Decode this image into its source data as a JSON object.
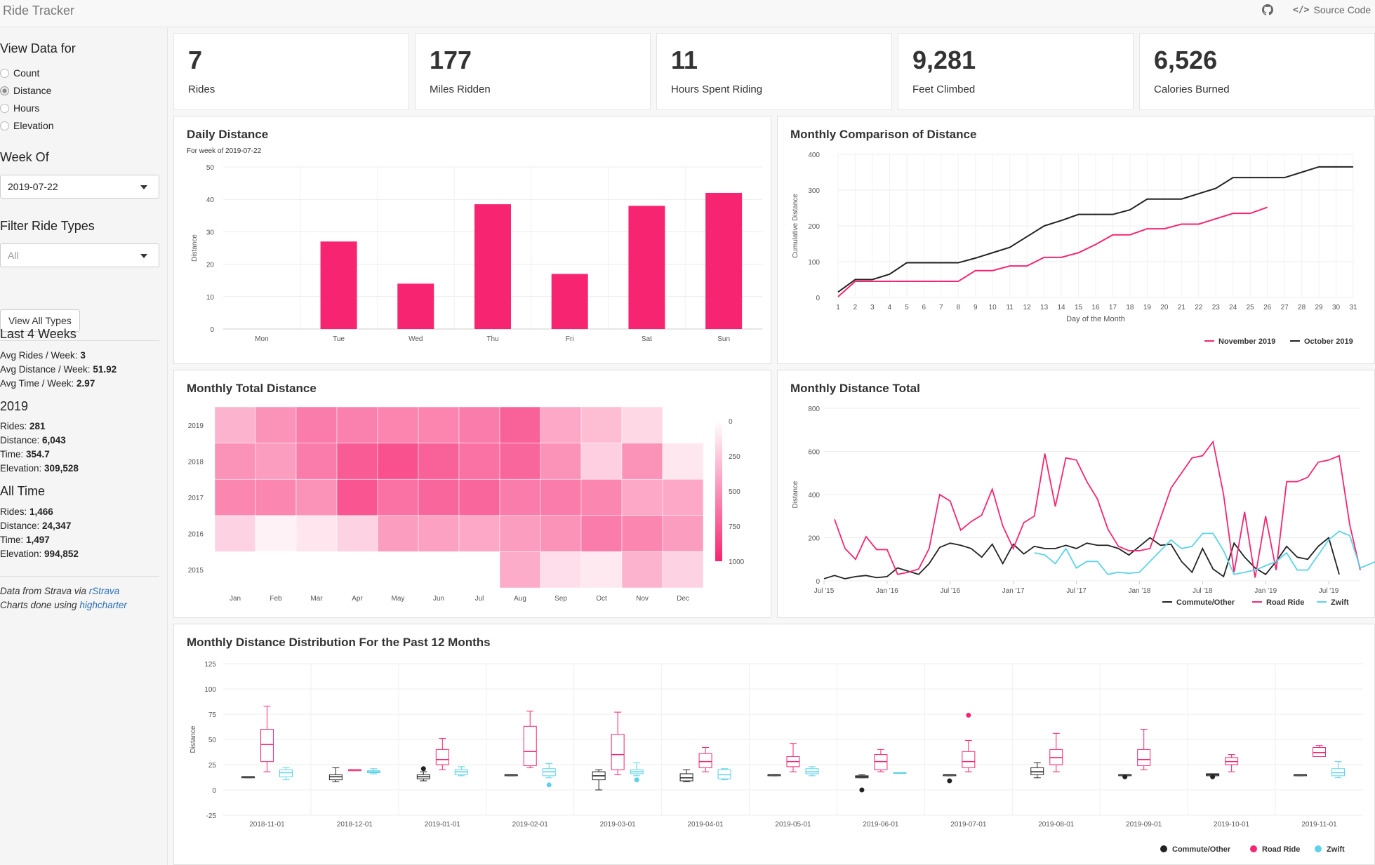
{
  "nav": {
    "brand": "Ride Tracker",
    "source_code": "Source Code"
  },
  "sidebar": {
    "view_heading": "View Data for",
    "view_options": [
      {
        "label": "Count",
        "checked": false
      },
      {
        "label": "Distance",
        "checked": true
      },
      {
        "label": "Hours",
        "checked": false
      },
      {
        "label": "Elevation",
        "checked": false
      }
    ],
    "week_heading": "Week Of",
    "week_value": "2019-07-22",
    "filter_heading": "Filter Ride Types",
    "filter_value": "All",
    "view_all_button": "View All Types",
    "last4_heading": "Last 4 Weeks",
    "last4": [
      {
        "label": "Avg Rides / Week: ",
        "value": "3"
      },
      {
        "label": "Avg Distance / Week: ",
        "value": "51.92"
      },
      {
        "label": "Avg Time / Week: ",
        "value": "2.97"
      }
    ],
    "y2019_heading": "2019",
    "y2019": [
      {
        "label": "Rides: ",
        "value": "281"
      },
      {
        "label": "Distance: ",
        "value": "6,043"
      },
      {
        "label": "Time: ",
        "value": "354.7"
      },
      {
        "label": "Elevation: ",
        "value": "309,528"
      }
    ],
    "alltime_heading": "All Time",
    "alltime": [
      {
        "label": "Rides: ",
        "value": "1,466"
      },
      {
        "label": "Distance: ",
        "value": "24,347"
      },
      {
        "label": "Time: ",
        "value": "1,497"
      },
      {
        "label": "Elevation: ",
        "value": "994,852"
      }
    ],
    "credit1_prefix": "Data from Strava via ",
    "credit1_link": "rStrava",
    "credit2_prefix": "Charts done using ",
    "credit2_link": "highcharter"
  },
  "value_boxes": [
    {
      "value": "7",
      "label": "Rides"
    },
    {
      "value": "177",
      "label": "Miles Ridden"
    },
    {
      "value": "11",
      "label": "Hours Spent Riding"
    },
    {
      "value": "9,281",
      "label": "Feet Climbed"
    },
    {
      "value": "6,526",
      "label": "Calories Burned"
    }
  ],
  "colors": {
    "pink": "#f72571",
    "black": "#222222",
    "cyan": "#5bd3e8"
  },
  "cards": {
    "daily": "Daily Distance",
    "monthly_comparison": "Monthly Comparison of Distance",
    "monthly_total": "Monthly Total Distance",
    "monthly_distance_total": "Monthly Distance Total",
    "distribution": "Monthly Distance Distribution For the Past 12 Months"
  },
  "chart_data": [
    {
      "id": "daily",
      "type": "bar",
      "title": "Daily Distance",
      "subtitle": "For week of 2019-07-22",
      "ylabel": "Distance",
      "xlabel": "",
      "categories": [
        "Mon",
        "Tue",
        "Wed",
        "Thu",
        "Fri",
        "Sat",
        "Sun"
      ],
      "values": [
        0,
        27,
        14,
        38.5,
        17,
        38,
        42
      ],
      "ylim": [
        0,
        50
      ],
      "yticks": [
        0,
        10,
        20,
        30,
        40,
        50
      ],
      "color": "#f72571"
    },
    {
      "id": "comparison",
      "type": "line",
      "title": "Monthly Comparison of Distance",
      "xlabel": "Day of the Month",
      "ylabel": "Cumulative Distance",
      "ylim": [
        0,
        400
      ],
      "yticks": [
        0,
        100,
        200,
        300,
        400
      ],
      "x": [
        1,
        2,
        3,
        4,
        5,
        6,
        7,
        8,
        9,
        10,
        11,
        12,
        13,
        14,
        15,
        16,
        17,
        18,
        19,
        20,
        21,
        22,
        23,
        24,
        25,
        26,
        27,
        28,
        29,
        30,
        31
      ],
      "legend_position": "bottom-right",
      "series": [
        {
          "name": "November 2019",
          "color": "#f72571",
          "values": [
            2,
            45,
            45,
            45,
            45,
            45,
            45,
            45,
            75,
            75,
            88,
            88,
            112,
            112,
            125,
            148,
            175,
            175,
            192,
            192,
            205,
            205,
            220,
            235,
            235,
            252
          ]
        },
        {
          "name": "October 2019",
          "color": "#222222",
          "values": [
            15,
            50,
            50,
            65,
            97,
            97,
            97,
            97,
            110,
            125,
            140,
            170,
            200,
            215,
            232,
            232,
            232,
            245,
            275,
            275,
            275,
            290,
            305,
            335,
            335,
            335,
            335,
            350,
            365,
            365,
            365
          ]
        }
      ]
    },
    {
      "id": "heatmap",
      "type": "heatmap",
      "title": "Monthly Total Distance",
      "x_categories": [
        "Jan",
        "Feb",
        "Mar",
        "Apr",
        "May",
        "Jun",
        "Jul",
        "Aug",
        "Sep",
        "Oct",
        "Nov",
        "Dec"
      ],
      "y_categories": [
        "2019",
        "2018",
        "2017",
        "2016",
        "2015"
      ],
      "color_range": [
        0,
        1000
      ],
      "legend_ticks": [
        0,
        250,
        500,
        750,
        1000
      ],
      "values": [
        [
          350,
          500,
          600,
          580,
          560,
          560,
          600,
          720,
          400,
          300,
          180,
          null
        ],
        [
          500,
          450,
          600,
          750,
          800,
          720,
          650,
          700,
          500,
          220,
          500,
          110
        ],
        [
          550,
          550,
          500,
          780,
          650,
          700,
          700,
          600,
          600,
          550,
          400,
          400
        ],
        [
          200,
          60,
          120,
          200,
          450,
          430,
          400,
          450,
          500,
          600,
          550,
          450
        ],
        [
          null,
          null,
          null,
          null,
          null,
          null,
          null,
          380,
          150,
          100,
          350,
          200
        ]
      ]
    },
    {
      "id": "timeseries",
      "type": "line",
      "title": "Monthly Distance Total",
      "ylabel": "Distance",
      "ylim": [
        0,
        800
      ],
      "yticks": [
        0,
        200,
        400,
        600,
        800
      ],
      "xticks": [
        "Jul '15",
        "Jan '16",
        "Jul '16",
        "Jan '17",
        "Jul '17",
        "Jan '18",
        "Jul '18",
        "Jan '19",
        "Jul '19"
      ],
      "legend_position": "bottom-right",
      "series": [
        {
          "name": "Commute/Other",
          "color": "#222222",
          "start_month": 0,
          "values": [
            10,
            25,
            10,
            20,
            25,
            15,
            20,
            60,
            45,
            30,
            80,
            155,
            175,
            165,
            150,
            110,
            170,
            80,
            170,
            125,
            160,
            150,
            150,
            165,
            150,
            175,
            165,
            165,
            150,
            120,
            160,
            200,
            165,
            170,
            90,
            40,
            150,
            55,
            20,
            175,
            110,
            60,
            30,
            90,
            160,
            110,
            100,
            160,
            200,
            30
          ]
        },
        {
          "name": "Road Ride",
          "color": "#f72571",
          "start_month": 1,
          "values": [
            285,
            150,
            100,
            205,
            145,
            145,
            30,
            40,
            55,
            150,
            400,
            370,
            235,
            275,
            305,
            425,
            255,
            150,
            270,
            300,
            590,
            345,
            570,
            560,
            460,
            380,
            240,
            160,
            140,
            140,
            150,
            290,
            430,
            500,
            570,
            580,
            645,
            400,
            40,
            320,
            15,
            300,
            50,
            460,
            460,
            480,
            550,
            560,
            580,
            260,
            50
          ]
        },
        {
          "name": "Zwift",
          "color": "#5bd3e8",
          "start_month": 20,
          "values": [
            130,
            120,
            80,
            150,
            60,
            90,
            90,
            30,
            40,
            35,
            40,
            90,
            140,
            190,
            150,
            160,
            220,
            220,
            140,
            30,
            40,
            50,
            70,
            90,
            130,
            50,
            50,
            120,
            190,
            230,
            210,
            60,
            80,
            100,
            20,
            40,
            60,
            80,
            100,
            120,
            140
          ]
        }
      ]
    },
    {
      "id": "boxplot",
      "type": "boxplot",
      "title": "Monthly Distance Distribution For the Past 12 Months",
      "ylabel": "Distance",
      "ylim": [
        -25,
        125
      ],
      "yticks": [
        -25,
        0,
        25,
        50,
        75,
        100,
        125
      ],
      "categories": [
        "2018-11-01",
        "2018-12-01",
        "2019-01-01",
        "2019-02-01",
        "2019-03-01",
        "2019-04-01",
        "2019-05-01",
        "2019-06-01",
        "2019-07-01",
        "2019-08-01",
        "2019-09-01",
        "2019-10-01",
        "2019-11-01"
      ],
      "legend_position": "bottom-right",
      "series": [
        {
          "name": "Commute/Other",
          "color": "#222222",
          "boxes": [
            [
              12,
              12,
              13,
              13,
              13
            ],
            [
              8,
              10,
              13,
              15,
              22
            ],
            [
              9,
              11,
              13,
              15,
              18
            ],
            [
              14,
              14,
              15,
              15,
              15
            ],
            [
              0,
              10,
              14,
              18,
              20
            ],
            [
              8,
              9,
              12,
              16,
              20
            ],
            [
              14,
              14,
              15,
              15,
              15
            ],
            [
              12,
              12,
              13,
              14,
              15
            ],
            [
              14,
              14,
              15,
              15,
              15
            ],
            [
              12,
              15,
              18,
              22,
              27
            ],
            [
              14,
              14,
              15,
              15,
              15
            ],
            [
              14,
              14,
              15,
              16,
              16
            ],
            [
              14,
              14,
              15,
              15,
              15
            ]
          ],
          "outliers": [
            [],
            [],
            [
              21
            ],
            [],
            [],
            [],
            [],
            [
              0
            ],
            [
              9
            ],
            [],
            [
              13
            ],
            [
              13
            ],
            []
          ]
        },
        {
          "name": "Road Ride",
          "color": "#f72571",
          "boxes": [
            [
              18,
              28,
              45,
              60,
              83
            ],
            [
              19,
              19,
              20,
              20,
              20
            ],
            [
              20,
              25,
              30,
              40,
              51
            ],
            [
              22,
              24,
              38,
              63,
              78
            ],
            [
              15,
              20,
              35,
              55,
              77
            ],
            [
              18,
              22,
              28,
              36,
              42
            ],
            [
              18,
              23,
              28,
              33,
              46
            ],
            [
              18,
              20,
              28,
              35,
              40
            ],
            [
              18,
              22,
              28,
              38,
              49
            ],
            [
              18,
              25,
              32,
              40,
              56
            ],
            [
              20,
              24,
              30,
              40,
              60
            ],
            [
              18,
              25,
              28,
              32,
              35
            ],
            [
              33,
              33,
              37,
              42,
              44
            ]
          ],
          "outliers": [
            [],
            [],
            [],
            [],
            [],
            [],
            [],
            [],
            [
              74
            ],
            [],
            [],
            [],
            []
          ]
        },
        {
          "name": "Zwift",
          "color": "#5bd3e8",
          "boxes": [
            [
              10,
              13,
              17,
              20,
              22
            ],
            [
              16,
              17,
              18,
              19,
              21
            ],
            [
              14,
              15,
              18,
              20,
              23
            ],
            [
              12,
              14,
              18,
              21,
              26
            ],
            [
              14,
              16,
              18,
              20,
              27
            ],
            [
              10,
              11,
              15,
              20,
              21
            ],
            [
              14,
              16,
              18,
              21,
              23
            ],
            [
              17,
              17,
              17,
              17,
              17
            ],
            null,
            null,
            null,
            null,
            [
              12,
              14,
              17,
              21,
              28
            ]
          ],
          "outliers": [
            [],
            [],
            [],
            [
              5
            ],
            [
              10
            ],
            [],
            [],
            [],
            [],
            [],
            [],
            [],
            []
          ]
        }
      ]
    }
  ]
}
